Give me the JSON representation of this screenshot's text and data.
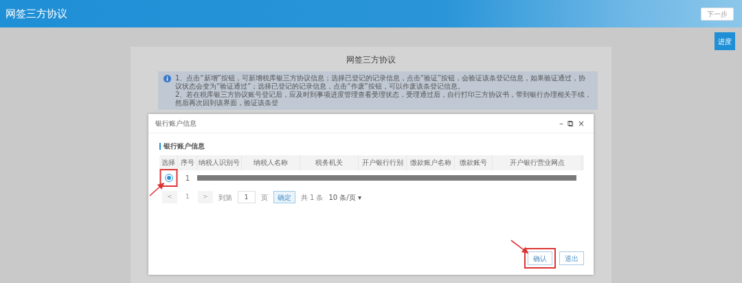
{
  "header": {
    "title": "网签三方协议",
    "next_button": "下一步"
  },
  "progress_button": "进度",
  "panel": {
    "title": "网签三方协议",
    "notices": [
      "1、点击“新增”按钮，可新增税库银三方协议信息；选择已登记的记录信息，点击“验证”按钮，会验证该条登记信息，如果验证通过，协议状态会变为“验证通过”；选择已登记的记录信息，点击“作废”按钮，可以作废该条登记信息。",
      "2、若在税库银三方协议账号登记后，应及时到事项进度管理查看受理状态，受理通过后，自行打印三方协议书，带到银行办理相关手续，然后再次回到该界面，验证该条登"
    ]
  },
  "dialog": {
    "title": "银行账户信息",
    "controls": [
      "–",
      "⧉",
      "×"
    ],
    "section_title": "银行账户信息",
    "table": {
      "columns": [
        "选择",
        "序号",
        "纳税人识别号",
        "纳税人名称",
        "税务机关",
        "开户银行行别",
        "缴款账户名称",
        "缴款账号",
        "开户银行营业网点"
      ],
      "rows": [
        {
          "selected": true,
          "index": "1"
        }
      ]
    },
    "pagination": {
      "prev": "<",
      "page": "1",
      "next": ">",
      "goto_label": "到第",
      "goto_value": "1",
      "page_unit": "页",
      "confirm": "确定",
      "total": "共 1 条",
      "page_size": "10 条/页",
      "page_size_caret": "▾"
    },
    "buttons": [
      "确认",
      "退出"
    ]
  }
}
